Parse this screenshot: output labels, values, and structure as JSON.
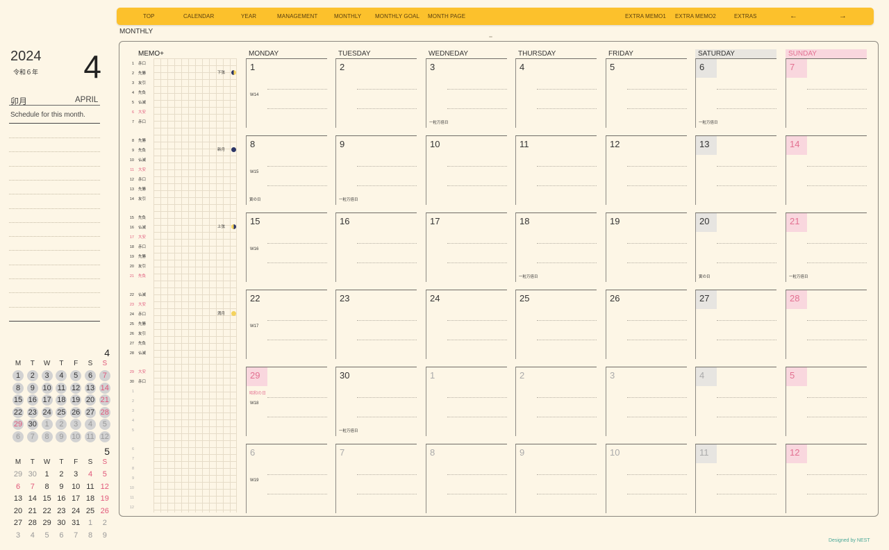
{
  "nav": {
    "items": [
      "TOP",
      "CALENDAR",
      "YEAR",
      "MANAGEMENT",
      "MONTHLY",
      "MONTHLY GOAL",
      "MONTH PAGE",
      "EXTRA MEMO1",
      "EXTRA MEMO2",
      "EXTRAS"
    ],
    "prev_arrow": "←",
    "next_arrow": "→"
  },
  "page_label": "MONTHLY",
  "left": {
    "year": "2024",
    "era": "令和６年",
    "month_number": "4",
    "month_jp": "卯月",
    "month_en": "APRIL",
    "schedule_label": "Schedule for this month."
  },
  "mini_calendars": [
    {
      "month": "4",
      "weekdays": [
        "M",
        "T",
        "W",
        "T",
        "F",
        "S",
        "S"
      ],
      "days": [
        "1",
        "2",
        "3",
        "4",
        "5",
        "6",
        "7",
        "8",
        "9",
        "10",
        "11",
        "12",
        "13",
        "14",
        "15",
        "16",
        "17",
        "18",
        "19",
        "20",
        "21",
        "22",
        "23",
        "24",
        "25",
        "26",
        "27",
        "28",
        "29",
        "30",
        "1",
        "2",
        "3",
        "4",
        "5",
        "6",
        "7",
        "8",
        "9",
        "10",
        "11",
        "12"
      ]
    },
    {
      "month": "5",
      "weekdays": [
        "M",
        "T",
        "W",
        "T",
        "F",
        "S",
        "S"
      ],
      "days": [
        "29",
        "30",
        "1",
        "2",
        "3",
        "4",
        "5",
        "6",
        "7",
        "8",
        "9",
        "10",
        "11",
        "12",
        "13",
        "14",
        "15",
        "16",
        "17",
        "18",
        "19",
        "20",
        "21",
        "22",
        "23",
        "24",
        "25",
        "26",
        "27",
        "28",
        "29",
        "30",
        "31",
        "1",
        "2",
        "3",
        "4",
        "5",
        "6",
        "7",
        "8",
        "9"
      ]
    }
  ],
  "memo": {
    "header": "MEMO+",
    "rows": [
      {
        "n": "1",
        "k": "赤口"
      },
      {
        "n": "2",
        "k": "先勝"
      },
      {
        "n": "3",
        "k": "友引"
      },
      {
        "n": "4",
        "k": "先負"
      },
      {
        "n": "5",
        "k": "仏滅"
      },
      {
        "n": "6",
        "k": "大安"
      },
      {
        "n": "7",
        "k": "赤口"
      },
      {
        "n": "8",
        "k": "先勝"
      },
      {
        "n": "9",
        "k": "先負"
      },
      {
        "n": "10",
        "k": "仏滅"
      },
      {
        "n": "11",
        "k": "大安"
      },
      {
        "n": "12",
        "k": "赤口"
      },
      {
        "n": "13",
        "k": "先勝"
      },
      {
        "n": "14",
        "k": "友引"
      },
      {
        "n": "15",
        "k": "先負"
      },
      {
        "n": "16",
        "k": "仏滅"
      },
      {
        "n": "17",
        "k": "大安"
      },
      {
        "n": "18",
        "k": "赤口"
      },
      {
        "n": "19",
        "k": "先勝"
      },
      {
        "n": "20",
        "k": "友引"
      },
      {
        "n": "21",
        "k": "先負"
      },
      {
        "n": "22",
        "k": "仏滅"
      },
      {
        "n": "23",
        "k": "大安"
      },
      {
        "n": "24",
        "k": "赤口"
      },
      {
        "n": "25",
        "k": "先勝"
      },
      {
        "n": "26",
        "k": "友引"
      },
      {
        "n": "27",
        "k": "先負"
      },
      {
        "n": "28",
        "k": "仏滅"
      },
      {
        "n": "29",
        "k": "大安"
      },
      {
        "n": "30",
        "k": "赤口"
      },
      {
        "n": "1",
        "k": ""
      },
      {
        "n": "2",
        "k": ""
      },
      {
        "n": "3",
        "k": ""
      },
      {
        "n": "4",
        "k": ""
      },
      {
        "n": "5",
        "k": ""
      },
      {
        "n": "6",
        "k": ""
      },
      {
        "n": "7",
        "k": ""
      },
      {
        "n": "8",
        "k": ""
      },
      {
        "n": "9",
        "k": ""
      },
      {
        "n": "10",
        "k": ""
      },
      {
        "n": "11",
        "k": ""
      },
      {
        "n": "12",
        "k": ""
      }
    ],
    "phases": [
      "下弦",
      "新月",
      "上弦",
      "満月"
    ]
  },
  "weekdays": [
    "MONDAY",
    "TUESDAY",
    "WEDNEDAY",
    "THURSDAY",
    "FRIDAY",
    "SATURDAY",
    "SUNDAY"
  ],
  "weeks": [
    {
      "label": "W14",
      "days": [
        "1",
        "2",
        "3",
        "4",
        "5",
        "6",
        "7"
      ]
    },
    {
      "label": "W15",
      "days": [
        "8",
        "9",
        "10",
        "11",
        "12",
        "13",
        "14"
      ]
    },
    {
      "label": "W16",
      "days": [
        "15",
        "16",
        "17",
        "18",
        "19",
        "20",
        "21"
      ]
    },
    {
      "label": "W17",
      "days": [
        "22",
        "23",
        "24",
        "25",
        "26",
        "27",
        "28"
      ]
    },
    {
      "label": "W18",
      "days": [
        "29",
        "30",
        "1",
        "2",
        "3",
        "4",
        "5"
      ]
    },
    {
      "label": "W19",
      "days": [
        "6",
        "7",
        "8",
        "9",
        "10",
        "11",
        "12"
      ]
    }
  ],
  "notes": {
    "w0d2": "一粒万倍日",
    "w0d5": "一粒万倍日",
    "w1d0": "寅の日",
    "w1d1": "一粒万倍日",
    "w2d3": "一粒万倍日",
    "w2d5": "寅の日",
    "w2d6": "一粒万倍日",
    "w4d1": "一粒万倍日"
  },
  "holidays": {
    "w4d0": "昭和の日"
  },
  "credit": "Designed by NEST",
  "colors": {
    "nav": "#fcc12c",
    "background": "#fdf6e6",
    "sunday": "#e37091",
    "saturday_bg": "#e7e5e1",
    "sunday_bg": "#f9d7de",
    "accent_credit": "#49a898"
  }
}
